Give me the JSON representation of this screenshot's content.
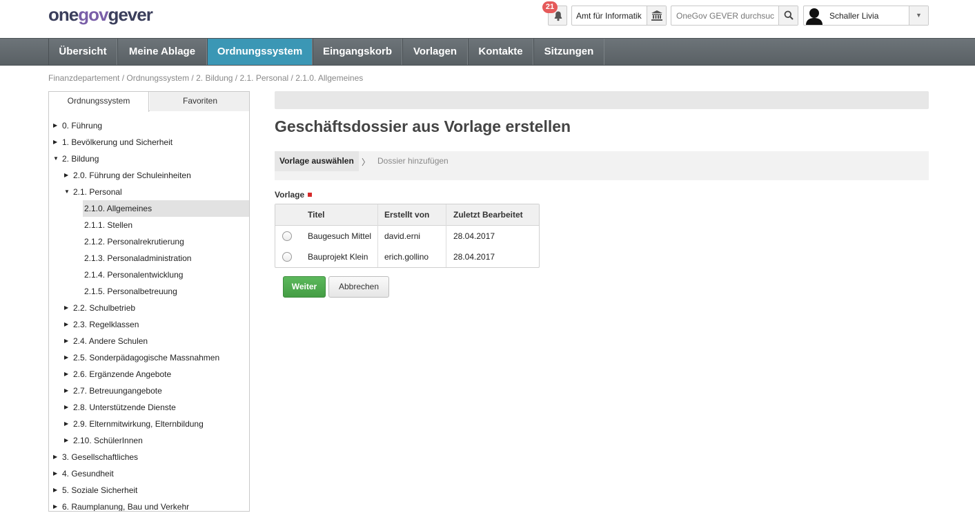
{
  "brand": {
    "part1": "one",
    "part2": "gov",
    "part3": "gever"
  },
  "header": {
    "notification_count": "21",
    "org_unit": "Amt für Informatik",
    "search_placeholder": "OneGov GEVER durchsuchen",
    "user_name": "Schaller Livia"
  },
  "nav": {
    "items": [
      {
        "label": "Übersicht"
      },
      {
        "label": "Meine Ablage"
      },
      {
        "label": "Ordnungssystem"
      },
      {
        "label": "Eingangskorb"
      },
      {
        "label": "Vorlagen"
      },
      {
        "label": "Kontakte"
      },
      {
        "label": "Sitzungen"
      }
    ],
    "active_color": "#3b97b5"
  },
  "breadcrumb": "Finanzdepartement / Ordnungssystem / 2. Bildung / 2.1. Personal / 2.1.0. Allgemeines",
  "sidebar": {
    "tabs": [
      {
        "label": "Ordnungssystem"
      },
      {
        "label": "Favoriten"
      }
    ],
    "tree": [
      {
        "label": "0. Führung",
        "icon": "collapsed"
      },
      {
        "label": "1. Bevölkerung und Sicherheit",
        "icon": "collapsed"
      },
      {
        "label": "2. Bildung",
        "icon": "expanded"
      },
      {
        "label": "2.0. Führung der Schuleinheiten",
        "icon": "collapsed"
      },
      {
        "label": "2.1. Personal",
        "icon": "expanded"
      },
      {
        "label": "2.1.0. Allgemeines",
        "selected": true
      },
      {
        "label": "2.1.1. Stellen"
      },
      {
        "label": "2.1.2. Personalrekrutierung"
      },
      {
        "label": "2.1.3. Personaladministration"
      },
      {
        "label": "2.1.4. Personalentwicklung"
      },
      {
        "label": "2.1.5. Personalbetreuung"
      },
      {
        "label": "2.2. Schulbetrieb",
        "icon": "collapsed"
      },
      {
        "label": "2.3. Regelklassen",
        "icon": "collapsed"
      },
      {
        "label": "2.4. Andere Schulen",
        "icon": "collapsed"
      },
      {
        "label": "2.5. Sonderpädagogische Massnahmen",
        "icon": "collapsed"
      },
      {
        "label": "2.6. Ergänzende Angebote",
        "icon": "collapsed"
      },
      {
        "label": "2.7. Betreuungangebote",
        "icon": "collapsed"
      },
      {
        "label": "2.8. Unterstützende Dienste",
        "icon": "collapsed"
      },
      {
        "label": "2.9. Elternmitwirkung, Elternbildung",
        "icon": "collapsed"
      },
      {
        "label": "2.10. SchülerInnen",
        "icon": "collapsed"
      },
      {
        "label": "3. Gesellschaftliches",
        "icon": "collapsed"
      },
      {
        "label": "4. Gesundheit",
        "icon": "collapsed"
      },
      {
        "label": "5. Soziale Sicherheit",
        "icon": "collapsed"
      },
      {
        "label": "6. Raumplanung, Bau und Verkehr",
        "icon": "collapsed"
      }
    ]
  },
  "main": {
    "title": "Geschäftsdossier aus Vorlage erstellen",
    "wizard": {
      "step1": "Vorlage auswählen",
      "separator": "〉",
      "step2": "Dossier hinzufügen"
    },
    "field_label": "Vorlage",
    "table": {
      "columns": [
        "Titel",
        "Erstellt von",
        "Zuletzt Bearbeitet"
      ],
      "rows": [
        {
          "title": "Baugesuch Mittel",
          "created_by": "david.erni",
          "modified": "28.04.2017"
        },
        {
          "title": "Bauprojekt Klein",
          "created_by": "erich.gollino",
          "modified": "28.04.2017"
        }
      ]
    },
    "buttons": {
      "primary": "Weiter",
      "secondary": "Abbrechen"
    }
  }
}
